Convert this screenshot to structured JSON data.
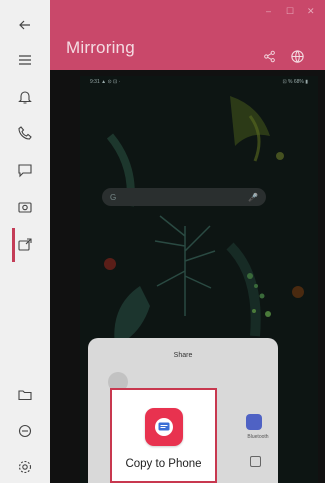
{
  "window": {
    "title": "Mirroring",
    "controls": [
      "–",
      "☐",
      "✕"
    ]
  },
  "rail": {
    "items": [
      {
        "name": "back-arrow-icon"
      },
      {
        "name": "menu-icon"
      },
      {
        "name": "bell-icon"
      },
      {
        "name": "phone-call-icon"
      },
      {
        "name": "message-icon"
      },
      {
        "name": "photo-icon"
      },
      {
        "name": "mirroring-icon",
        "selected": true
      },
      {
        "name": "folder-icon"
      },
      {
        "name": "minus-circle-icon"
      },
      {
        "name": "settings-icon"
      }
    ]
  },
  "header": {
    "share_icon": "share-icon",
    "globe_icon": "globe-icon"
  },
  "phone": {
    "status_left": "9:31 ▲ ⊙ ⊡ ·",
    "status_right": "⊡ % 68% ▮",
    "search": {
      "left": "G",
      "right": "🎤"
    },
    "share_sheet": {
      "title": "Share",
      "side_app_label": "Bluetooth"
    }
  },
  "highlight": {
    "app_label": "Copy to Phone"
  },
  "colors": {
    "accent": "#c9486a",
    "highlight_border": "#c8384f",
    "app_icon": "#e8324f"
  }
}
